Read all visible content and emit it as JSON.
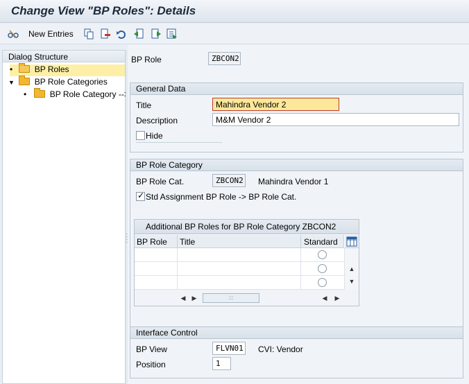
{
  "window": {
    "title": "Change View \"BP Roles\": Details"
  },
  "toolbar": {
    "new_entries_label": "New Entries",
    "icons": [
      "glasses-toggle-icon",
      "copy-icon",
      "delete-icon",
      "undo-icon",
      "previous-entry-icon",
      "next-entry-icon",
      "select-all-icon"
    ]
  },
  "dialog_structure": {
    "header": "Dialog Structure",
    "items": [
      {
        "label": "BP Roles",
        "level": 0,
        "selected": true
      },
      {
        "label": "BP Role Categories",
        "level": 0,
        "expanded": true
      },
      {
        "label": "BP Role Category -->",
        "level": 1
      }
    ]
  },
  "bp_role": {
    "label": "BP Role",
    "value": "ZBCON2"
  },
  "general_data": {
    "header": "General Data",
    "title_label": "Title",
    "title_value": "Mahindra Vendor 2",
    "description_label": "Description",
    "description_value": "M&M Vendor 2",
    "hide_label": "Hide",
    "hide_checked": false
  },
  "role_category": {
    "header": "BP Role Category",
    "cat_label": "BP Role Cat.",
    "cat_value": "ZBCON2",
    "cat_text": "Mahindra Vendor 1",
    "std_assign_label": "Std Assignment BP Role -> BP Role Cat.",
    "std_assign_checked": true
  },
  "additional_roles": {
    "title": "Additional BP Roles for BP Role Category ZBCON2",
    "columns": [
      "BP Role",
      "Title",
      "Standard"
    ],
    "rows": [
      {
        "bp_role": "",
        "title": "",
        "standard": false
      },
      {
        "bp_role": "",
        "title": "",
        "standard": false
      },
      {
        "bp_role": "",
        "title": "",
        "standard": false
      }
    ]
  },
  "interface_control": {
    "header": "Interface Control",
    "bp_view_label": "BP View",
    "bp_view_value": "FLVN01",
    "bp_view_text": "CVI: Vendor",
    "position_label": "Position",
    "position_value": "1"
  },
  "colors": {
    "focus_field": "#fbe89a",
    "selected_tree": "#fdf0a6",
    "folder": "#f2b630"
  }
}
